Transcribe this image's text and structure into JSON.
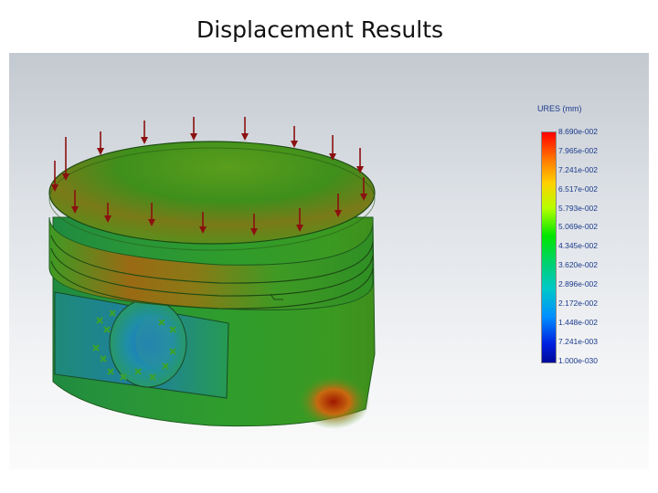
{
  "slide": {
    "title": "Displacement Results"
  },
  "legend": {
    "title": "URES (mm)",
    "labels": [
      "8.690e-002",
      "7.965e-002",
      "7.241e-002",
      "6.517e-002",
      "5.793e-002",
      "5.069e-002",
      "4.345e-002",
      "3.620e-002",
      "2.896e-002",
      "2.172e-002",
      "1.448e-002",
      "7.241e-003",
      "1.000e-030"
    ],
    "colors": [
      "#ff0000",
      "#ff7a00",
      "#ffd000",
      "#b4ff00",
      "#00e600",
      "#00d07a",
      "#00c8c8",
      "#0090ff",
      "#0020e0",
      "#000a9a"
    ]
  },
  "model": {
    "load_arrow_color": "#8b1010",
    "fixture_color": "#3aa32a",
    "part_base_color": "#2f9a2a"
  }
}
